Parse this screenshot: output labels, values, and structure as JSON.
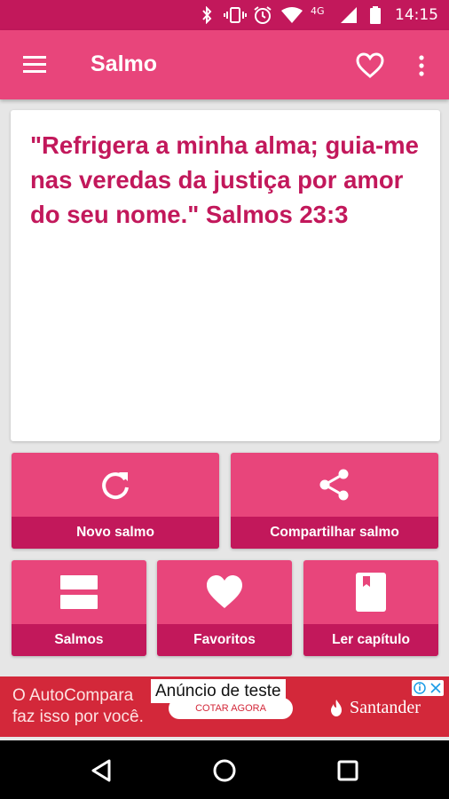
{
  "status_bar": {
    "network": "4G",
    "time": "14:15"
  },
  "app_bar": {
    "title": "Salmo"
  },
  "verse": {
    "text": "\"Refrigera a minha alma; guia-me nas veredas da justiça por amor do seu nome.\" Salmos 23:3"
  },
  "actions": {
    "new_psalm": {
      "label": "Novo salmo",
      "icon": "refresh-icon"
    },
    "share_psalm": {
      "label": "Compartilhar salmo",
      "icon": "share-icon"
    },
    "psalms": {
      "label": "Salmos",
      "icon": "list-icon"
    },
    "favorites": {
      "label": "Favoritos",
      "icon": "heart-icon"
    },
    "read_chapter": {
      "label": "Ler capítulo",
      "icon": "book-icon"
    }
  },
  "ad": {
    "text_line1": "O AutoCompara",
    "text_line2": "faz isso por você.",
    "button": "COTAR AGORA",
    "tag": "Anúncio de teste",
    "brand": "Santander"
  },
  "colors": {
    "primary": "#e8457b",
    "primary_dark": "#c2185b",
    "background": "#e6e6e6",
    "ad_red": "#d3283a"
  }
}
